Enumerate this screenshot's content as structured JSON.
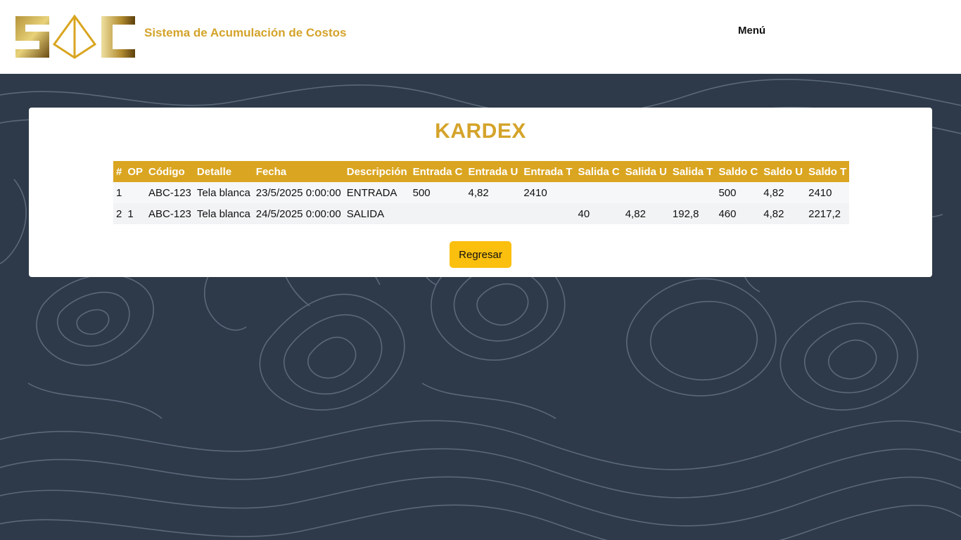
{
  "header": {
    "brand_title": "Sistema de Acumulación de Costos",
    "menu_label": "Menú",
    "logo_text": "SAC"
  },
  "colors": {
    "accent": "#daa520",
    "title": "#d4a32a",
    "button": "#fbbf0e",
    "background": "#2e3a4a"
  },
  "main": {
    "title": "KARDEX",
    "back_button": "Regresar"
  },
  "table": {
    "columns": [
      "#",
      "OP",
      "Código",
      "Detalle",
      "Fecha",
      "Descripción",
      "Entrada C",
      "Entrada U",
      "Entrada T",
      "Salida C",
      "Salida U",
      "Salida T",
      "Saldo C",
      "Saldo U",
      "Saldo T"
    ],
    "rows": [
      [
        "1",
        "",
        "ABC-123",
        "Tela blanca",
        "23/5/2025 0:00:00",
        "ENTRADA",
        "500",
        "4,82",
        "2410",
        "",
        "",
        "",
        "500",
        "4,82",
        "2410"
      ],
      [
        "2",
        "1",
        "ABC-123",
        "Tela blanca",
        "24/5/2025 0:00:00",
        "SALIDA",
        "",
        "",
        "",
        "40",
        "4,82",
        "192,8",
        "460",
        "4,82",
        "2217,2"
      ]
    ]
  }
}
